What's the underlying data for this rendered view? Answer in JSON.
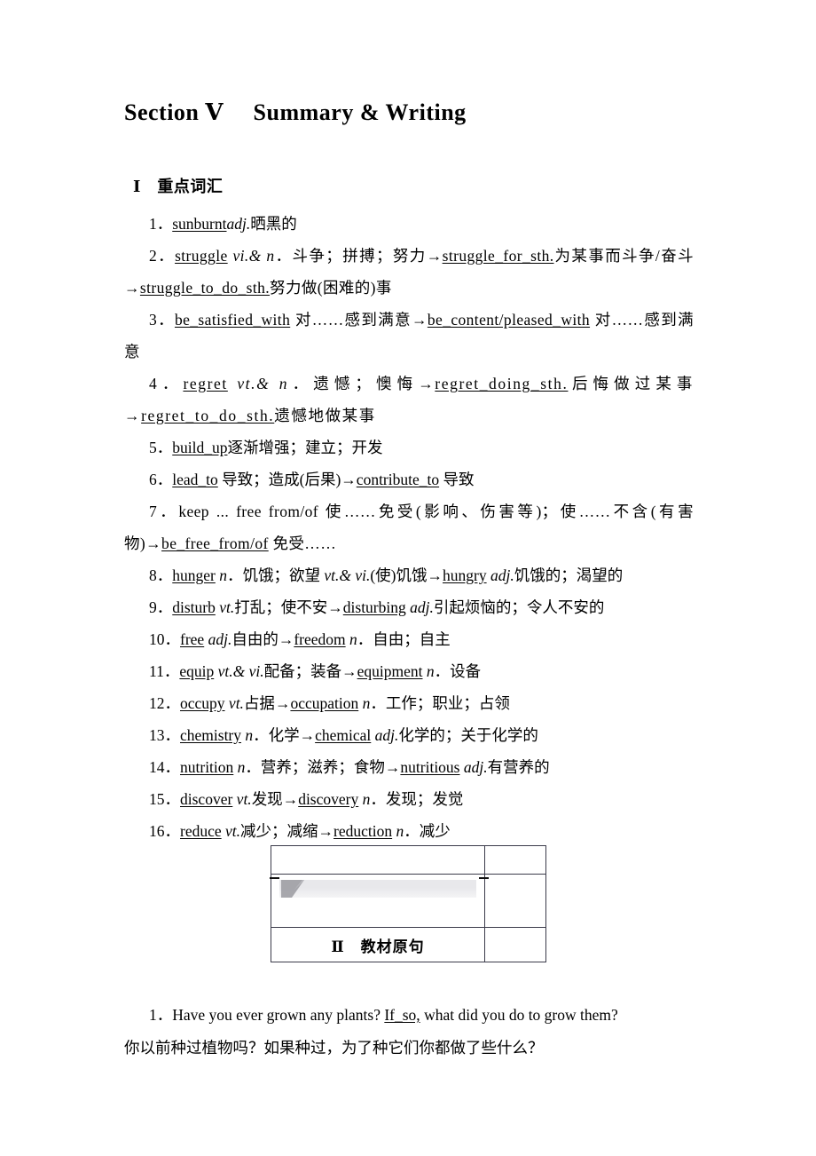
{
  "title": "Section Ⅴ  Summary & Writing",
  "sections": {
    "vocab_heading": "Ⅰ 重点词汇",
    "sentences_heading": "Ⅱ 教材原句"
  },
  "vocab": [
    {
      "num": "1．",
      "parts": "sunburnt adj.晒黑的"
    },
    {
      "num": "2．",
      "parts": "struggle vi.& n．斗争；拼搏；努力→struggle_for_sth.为某事而斗争/奋斗→struggle_to_do_sth.努力做(困难的)事"
    },
    {
      "num": "3．",
      "parts": "be_satisfied_with 对……感到满意→be_content/pleased_with 对……感到满意"
    },
    {
      "num": "4．",
      "parts": "regret vt.& n．遗憾；懊悔→regret_doing_sth.后悔做过某事→regret_to_do_sth.遗憾地做某事"
    },
    {
      "num": "5．",
      "parts": "build_up 逐渐增强；建立；开发"
    },
    {
      "num": "6．",
      "parts": "lead_to 导致；造成(后果)→contribute_to 导致"
    },
    {
      "num": "7．",
      "parts": "keep ... free from/of 使……免受(影响、伤害等)；使……不含(有害物)→be_free_from/of 免受……"
    },
    {
      "num": "8．",
      "parts": "hunger n．饥饿；欲望 vt.& vi.(使)饥饿→hungry adj.饥饿的；渴望的"
    },
    {
      "num": "9．",
      "parts": "disturb vt.打乱；使不安→disturbing adj.引起烦恼的；令人不安的"
    },
    {
      "num": "10．",
      "parts": "free adj.自由的→freedom n．自由；自主"
    },
    {
      "num": "11．",
      "parts": "equip vt.& vi.配备；装备→equipment n．设备"
    },
    {
      "num": "12．",
      "parts": "occupy vt.占据→occupation n．工作；职业；占领"
    },
    {
      "num": "13．",
      "parts": "chemistry n．化学→chemical adj.化学的；关于化学的"
    },
    {
      "num": "14．",
      "parts": "nutrition n．营养；滋养；食物→nutritious adj.有营养的"
    },
    {
      "num": "15．",
      "parts": "discover vt.发现→discovery n．发现；发觉"
    },
    {
      "num": "16．",
      "parts": "reduce vt.减少；减缩→reduction n．减少"
    }
  ],
  "vocab_rich": {
    "i1": {
      "num": "1．",
      "head": "sunburnt",
      "pos": "adj.",
      "gloss": "晒黑的"
    },
    "i2": {
      "num": "2．",
      "head": "struggle",
      "pos": "vi.& n",
      "gloss": "．斗争；拼搏；努力",
      "d1": "struggle_for_sth.",
      "g1": "为某事而斗争/奋斗",
      "d2": "struggle_to_do_sth.",
      "g2": "努力做(困难的)事"
    },
    "i3": {
      "num": "3．",
      "head": "be_satisfied_with",
      "gloss": " 对……感到满意",
      "d1": "be_content/pleased_with",
      "g1": " 对……感到满意"
    },
    "i4": {
      "num": "4．",
      "head": "regret",
      "pos": "vt.& n",
      "gloss": "．遗憾；懊悔",
      "d1": "regret_doing_sth.",
      "g1": "后悔做过某事",
      "d2": "regret_to_do_sth.",
      "g2": "遗憾地做某事"
    },
    "i5": {
      "num": "5．",
      "head": "build_up",
      "gloss": "逐渐增强；建立；开发"
    },
    "i6": {
      "num": "6．",
      "head": "lead_to",
      "gloss": " 导致；造成(后果)",
      "d1": "contribute_to",
      "g1": " 导致"
    },
    "i7": {
      "num": "7．",
      "head": "keep ... free from/of",
      "gloss": " 使……免受(影响、伤害等)；使……不含(有害物)",
      "d1": "be_free_from/of",
      "g1": " 免受……"
    },
    "i8": {
      "num": "8．",
      "head": "hunger",
      "pos": "n",
      "gloss": "．饥饿；欲望 ",
      "pos2": "vt.& vi.",
      "gloss2": "(使)饥饿",
      "d1": "hungry",
      "pos3": "adj.",
      "g1": "饥饿的；渴望的"
    },
    "i9": {
      "num": "9．",
      "head": "disturb",
      "pos": "vt.",
      "gloss": "打乱；使不安",
      "d1": "disturbing",
      "pos3": "adj.",
      "g1": "引起烦恼的；令人不安的"
    },
    "i10": {
      "num": "10．",
      "head": "free",
      "pos": "adj.",
      "gloss": "自由的",
      "d1": "freedom",
      "pos3": "n",
      "g1": "．自由；自主"
    },
    "i11": {
      "num": "11．",
      "head": "equip",
      "pos": "vt.& vi.",
      "gloss": "配备；装备",
      "d1": "equipment",
      "pos3": "n",
      "g1": "．设备"
    },
    "i12": {
      "num": "12．",
      "head": "occupy",
      "pos": "vt.",
      "gloss": "占据",
      "d1": "occupation",
      "pos3": "n",
      "g1": "．工作；职业；占领"
    },
    "i13": {
      "num": "13．",
      "head": "chemistry",
      "pos": "n",
      "gloss": "．化学",
      "d1": "chemical",
      "pos3": "adj.",
      "g1": "化学的；关于化学的"
    },
    "i14": {
      "num": "14．",
      "head": "nutrition",
      "pos": "n",
      "gloss": "．营养；滋养；食物",
      "d1": "nutritious",
      "pos3": "adj.",
      "g1": "有营养的"
    },
    "i15": {
      "num": "15．",
      "head": "discover",
      "pos": "vt.",
      "gloss": "发现",
      "d1": "discovery",
      "pos3": "n",
      "g1": "．发现；发觉"
    },
    "i16": {
      "num": "16．",
      "head": "reduce",
      "pos": "vt.",
      "gloss": "减少；减缩",
      "d1": "reduction",
      "pos3": "n",
      "g1": "．减少"
    }
  },
  "sentences": [
    {
      "num": "1．",
      "en_before": "Have you ever grown any plants? ",
      "en_underline": "If_so,",
      "en_after": " what did you do to grow them?",
      "cn": "你以前种过植物吗？如果种过，为了种它们你都做了些什么？"
    }
  ],
  "arrow": "→",
  "colors": {
    "text": "#000000",
    "table_border": "#3b3b4a",
    "band_gray": "#d4d4d9",
    "flag_gray": "#9a9aa0"
  }
}
